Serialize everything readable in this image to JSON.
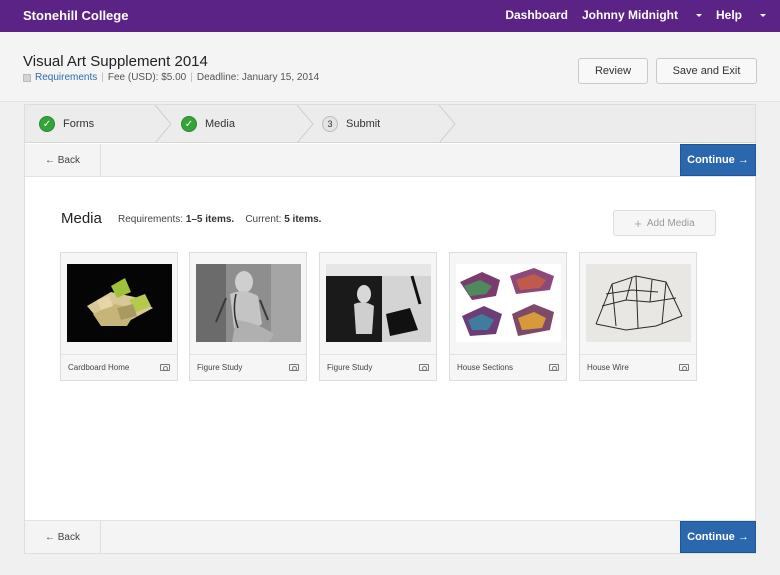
{
  "nav": {
    "brand": "Stonehill College",
    "dashboard": "Dashboard",
    "user": "Johnny Midnight",
    "help": "Help"
  },
  "header": {
    "title": "Visual Art Supplement 2014",
    "requirements": "Requirements",
    "fee": "Fee (USD): $5.00",
    "deadline": "Deadline: January 15, 2014",
    "review_label": "Review",
    "save_exit_label": "Save and Exit"
  },
  "steps": [
    {
      "label": "Forms",
      "status": "complete"
    },
    {
      "label": "Media",
      "status": "complete"
    },
    {
      "label": "Submit",
      "number": "3",
      "status": "pending"
    }
  ],
  "toolbar": {
    "back_label": "← Back",
    "continue_label": "Continue →"
  },
  "media": {
    "title": "Media",
    "requirements_label": "Requirements:",
    "requirements_value": "1–5 items.",
    "current_label": "Current:",
    "current_value": "5 items.",
    "add_label": "Add Media",
    "items": [
      {
        "label": "Cardboard Home"
      },
      {
        "label": "Figure Study"
      },
      {
        "label": "Figure Study"
      },
      {
        "label": "House Sections"
      },
      {
        "label": "House Wire"
      }
    ]
  },
  "colors": {
    "nav_bg": "#5a2385",
    "primary_button": "#2a67ad",
    "check_green": "#34a33a"
  }
}
